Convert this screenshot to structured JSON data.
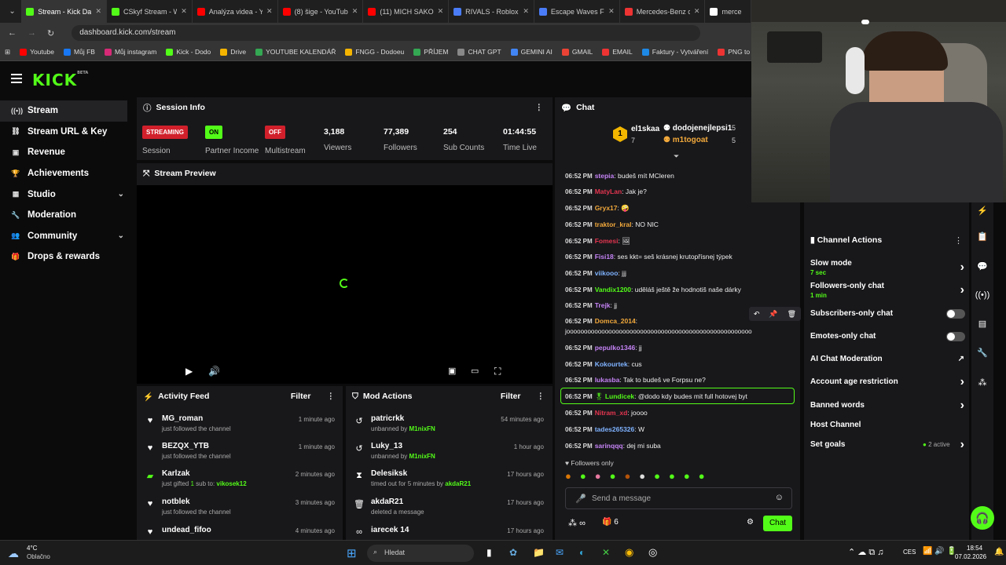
{
  "browser": {
    "tabs": [
      {
        "label": "Stream - Kick Das",
        "color": "#53fc18",
        "active": true
      },
      {
        "label": "CSkyf Stream - W",
        "color": "#53fc18"
      },
      {
        "label": "Analýza videa - Yo",
        "color": "#ff0000"
      },
      {
        "label": "(8) šige - YouTub",
        "color": "#ff0000"
      },
      {
        "label": "(11) MICH SAKO č",
        "color": "#ff0000"
      },
      {
        "label": "RIVALS - Roblox",
        "color": "#4a7cf7"
      },
      {
        "label": "Escape Waves For",
        "color": "#4a7cf7"
      },
      {
        "label": "Mercedes-Benz c/",
        "color": "#e33"
      },
      {
        "label": "merce",
        "color": "#fff"
      }
    ],
    "url": "dashboard.kick.com/stream",
    "bookmarks": [
      {
        "label": "Youtube",
        "color": "#ff0000"
      },
      {
        "label": "Můj FB",
        "color": "#1877f2"
      },
      {
        "label": "Můj instagram",
        "color": "#d62976"
      },
      {
        "label": "Kick - Dodo",
        "color": "#53fc18"
      },
      {
        "label": "Drive",
        "color": "#f4b400"
      },
      {
        "label": "YOUTUBE KALENDÁŘ",
        "color": "#34a853"
      },
      {
        "label": "FNGG - Dodoeu",
        "color": "#f4b400"
      },
      {
        "label": "PŘÍJEM",
        "color": "#34a853"
      },
      {
        "label": "CHAT GPT",
        "color": "#888"
      },
      {
        "label": "GEMINI AI",
        "color": "#4285f4"
      },
      {
        "label": "GMAIL",
        "color": "#ea4335"
      },
      {
        "label": "EMAIL",
        "color": "#e33"
      },
      {
        "label": "Faktury - Vytváření",
        "color": "#1e88e5"
      },
      {
        "label": "PNG to PDF",
        "color": "#e33"
      }
    ]
  },
  "brand": {
    "logo": "KICK",
    "beta": "BETA",
    "accent": "#53fc18"
  },
  "sidebar": {
    "items": [
      {
        "label": "Stream",
        "icon": "stream-icon",
        "glyph": "((•))"
      },
      {
        "label": "Stream URL & Key",
        "icon": "link-icon",
        "glyph": "⛓"
      },
      {
        "label": "Revenue",
        "icon": "revenue-icon",
        "glyph": "▣"
      },
      {
        "label": "Achievements",
        "icon": "trophy-icon",
        "glyph": "🏆"
      },
      {
        "label": "Studio",
        "icon": "studio-icon",
        "glyph": "▦"
      },
      {
        "label": "Moderation",
        "icon": "wrench-icon",
        "glyph": "🔧"
      },
      {
        "label": "Community",
        "icon": "community-icon",
        "glyph": "👥"
      },
      {
        "label": "Drops & rewards",
        "icon": "gift-icon",
        "glyph": "🎁"
      }
    ]
  },
  "session": {
    "title": "Session Info",
    "streaming_badge": "STREAMING",
    "streaming_label": "Session",
    "on_badge": "ON",
    "partner_label": "Partner Income",
    "off_badge": "OFF",
    "multistream_label": "Multistream",
    "viewers": "3,188",
    "viewers_label": "Viewers",
    "followers": "77,389",
    "followers_label": "Followers",
    "subs": "254",
    "subs_label": "Sub Counts",
    "time": "01:44:55",
    "time_label": "Time Live"
  },
  "preview": {
    "title": "Stream Preview"
  },
  "activity": {
    "title": "Activity Feed",
    "filter": "Filter",
    "items": [
      {
        "name": "MG_roman",
        "sub": "just followed the channel",
        "time": "1 minute ago"
      },
      {
        "name": "BEZQX_YTB",
        "sub": "just followed the channel",
        "time": "1 minute ago"
      },
      {
        "name": "Karlzak",
        "sub_pre": "just gifted ",
        "sub_count": "1",
        "sub_mid": " sub to: ",
        "sub_user": "vikosek12",
        "time": "2 minutes ago"
      },
      {
        "name": "notblek",
        "sub": "just followed the channel",
        "time": "3 minutes ago"
      },
      {
        "name": "undead_fifoo",
        "sub": "",
        "time": "4 minutes ago"
      }
    ]
  },
  "modactions": {
    "title": "Mod Actions",
    "filter": "Filter",
    "items": [
      {
        "name": "patricrkk",
        "sub_pre": "unbanned by ",
        "by": "M1nixFN",
        "time": "54 minutes ago"
      },
      {
        "name": "Luky_13",
        "sub_pre": "unbanned by ",
        "by": "M1nixFN",
        "time": "1 hour ago"
      },
      {
        "name": "Delesiksk",
        "sub_pre": "timed out for 5 minutes by ",
        "by": "akdaR21",
        "time": "17 hours ago"
      },
      {
        "name": "akdaR21",
        "sub_pre": "deleted a message",
        "by": "",
        "time": "17 hours ago"
      },
      {
        "name": "iarecek 14",
        "sub_pre": "",
        "by": "",
        "time": "17 hours ago"
      }
    ]
  },
  "chat": {
    "title": "Chat",
    "leaders": [
      {
        "rank": "1",
        "name": "el1skaa",
        "count": "7"
      },
      {
        "name": "dodojenejlepsi1",
        "count": "5"
      },
      {
        "name": "m1togoat",
        "count": "5"
      }
    ],
    "messages": [
      {
        "time": "06:52 PM",
        "user": "stepia",
        "color": "#c583f5",
        "text": ": budeš mít MCleren"
      },
      {
        "time": "06:52 PM",
        "user": "MatyLan",
        "color": "#e3354f",
        "text": ": Jak je?"
      },
      {
        "time": "06:52 PM",
        "user": "Gryx17",
        "color": "#f2a93b",
        "text": ": 🤪"
      },
      {
        "time": "06:52 PM",
        "user": "traktor_kral",
        "color": "#f2a93b",
        "text": ": NO NIC"
      },
      {
        "time": "06:52 PM",
        "user": "Fomesi",
        "color": "#e3354f",
        "text": ": 🖼"
      },
      {
        "time": "06:52 PM",
        "user": "Fisi18",
        "color": "#c583f5",
        "text": ": ses kkt= seš krásnej krutopřísnej týpek"
      },
      {
        "time": "06:52 PM",
        "user": "viikooo",
        "color": "#7fb3ff",
        "text": ": jjj"
      },
      {
        "time": "06:52 PM",
        "user": "Vandix1200",
        "color": "#53fc18",
        "text": ": uděláš ještě že hodnotiš naše dárky"
      },
      {
        "time": "06:52 PM",
        "user": "Trejk",
        "color": "#c583f5",
        "text": ": jj"
      },
      {
        "time": "06:52 PM",
        "user": "Domca_2014",
        "color": "#f2a93b",
        "text": ":",
        "text2": "jooooooooooooooooooooooooooooooooooooooooooooooooooooo"
      },
      {
        "time": "06:52 PM",
        "user": "pepulko1346",
        "color": "#c583f5",
        "text": ": jj"
      },
      {
        "time": "06:52 PM",
        "user": "Kokourtek",
        "color": "#7fb3ff",
        "text": ": cus"
      },
      {
        "time": "06:52 PM",
        "user": "lukasba",
        "color": "#c583f5",
        "text": ": Tak to budeš ve Forpsu ne?"
      },
      {
        "time": "06:52 PM",
        "user": "Lundicek",
        "color": "#53fc18",
        "text": ": @dodo kdy budes mit full hotovej byt"
      },
      {
        "time": "06:52 PM",
        "user": "Nitram_xd",
        "color": "#e3354f",
        "text": ": joooo"
      },
      {
        "time": "06:52 PM",
        "user": "tades265326",
        "color": "#7fb3ff",
        "text": ": W"
      },
      {
        "time": "06:52 PM",
        "user": "sarinqqq",
        "color": "#c583f5",
        "text": ": dej mi suba"
      }
    ],
    "followers_only": "Followers only",
    "placeholder": "Send a message",
    "points": "∞",
    "gifts": "6",
    "send": "Chat"
  },
  "channel_actions": {
    "title": "Channel Actions",
    "items": [
      {
        "label": "Slow mode",
        "sub": "7 sec",
        "control": "arrow"
      },
      {
        "label": "Followers-only chat",
        "sub": "1 min",
        "control": "arrow"
      },
      {
        "label": "Subscribers-only chat",
        "sub": "",
        "control": "toggle"
      },
      {
        "label": "Emotes-only chat",
        "sub": "",
        "control": "toggle"
      },
      {
        "label": "AI Chat Moderation",
        "sub": "",
        "control": "external"
      },
      {
        "label": "Account age restriction",
        "sub": "",
        "control": "arrow"
      },
      {
        "label": "Banned words",
        "sub": "",
        "control": "arrow"
      },
      {
        "label": "Host Channel",
        "sub": "",
        "control": "none"
      },
      {
        "label": "Set goals",
        "sub": "",
        "control": "arrow",
        "status": "2 active"
      }
    ]
  },
  "taskbar": {
    "temp": "4°C",
    "weather": "Oblačno",
    "search": "Hledat",
    "lang": "CES",
    "time": "18:54",
    "date": "07.02.2026"
  }
}
